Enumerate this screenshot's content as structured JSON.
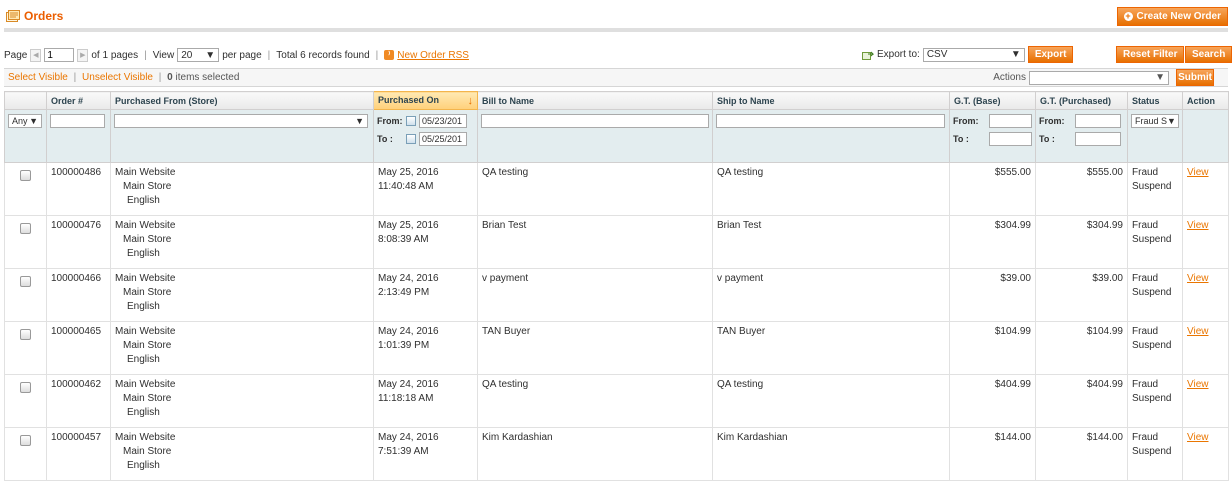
{
  "header": {
    "title": "Orders",
    "create_label": "Create New Order"
  },
  "pager": {
    "page_label": "Page",
    "page_value": "1",
    "of_pages": "of 1 pages",
    "view_label": "View",
    "view_value": "20",
    "per_page": "per page",
    "total": "Total 6 records found",
    "rss_label": "New Order RSS"
  },
  "export": {
    "label": "Export to:",
    "format": "CSV",
    "button": "Export"
  },
  "buttons": {
    "reset": "Reset Filter",
    "search": "Search"
  },
  "massaction": {
    "select_visible": "Select Visible",
    "unselect_visible": "Unselect Visible",
    "selected_count": "0",
    "selected_text": "items selected",
    "actions_label": "Actions",
    "submit": "Submit"
  },
  "columns": [
    "",
    "Order #",
    "Purchased From (Store)",
    "Purchased On",
    "Bill to Name",
    "Ship to Name",
    "G.T. (Base)",
    "G.T. (Purchased)",
    "Status",
    "Action"
  ],
  "filters": {
    "any": "Any",
    "from": "From:",
    "to": "To :",
    "date_from": "05/23/201",
    "date_to": "05/25/201",
    "status": "Fraud S"
  },
  "rows": [
    {
      "order": "100000486",
      "store1": "Main Website",
      "store2": "Main Store",
      "store3": "English",
      "date": "May 25, 2016 11:40:48 AM",
      "bill": "QA testing",
      "ship": "QA testing",
      "base": "$555.00",
      "purchased": "$555.00",
      "status": "Fraud Suspend",
      "action": "View"
    },
    {
      "order": "100000476",
      "store1": "Main Website",
      "store2": "Main Store",
      "store3": "English",
      "date": "May 25, 2016 8:08:39 AM",
      "bill": "Brian Test",
      "ship": "Brian Test",
      "base": "$304.99",
      "purchased": "$304.99",
      "status": "Fraud Suspend",
      "action": "View"
    },
    {
      "order": "100000466",
      "store1": "Main Website",
      "store2": "Main Store",
      "store3": "English",
      "date": "May 24, 2016 2:13:49 PM",
      "bill": "v payment",
      "ship": "v payment",
      "base": "$39.00",
      "purchased": "$39.00",
      "status": "Fraud Suspend",
      "action": "View"
    },
    {
      "order": "100000465",
      "store1": "Main Website",
      "store2": "Main Store",
      "store3": "English",
      "date": "May 24, 2016 1:01:39 PM",
      "bill": "TAN Buyer",
      "ship": "TAN Buyer",
      "base": "$104.99",
      "purchased": "$104.99",
      "status": "Fraud Suspend",
      "action": "View"
    },
    {
      "order": "100000462",
      "store1": "Main Website",
      "store2": "Main Store",
      "store3": "English",
      "date": "May 24, 2016 11:18:18 AM",
      "bill": "QA testing",
      "ship": "QA testing",
      "base": "$404.99",
      "purchased": "$404.99",
      "status": "Fraud Suspend",
      "action": "View"
    },
    {
      "order": "100000457",
      "store1": "Main Website",
      "store2": "Main Store",
      "store3": "English",
      "date": "May 24, 2016 7:51:39 AM",
      "bill": "Kim Kardashian",
      "ship": "Kim Kardashian",
      "base": "$144.00",
      "purchased": "$144.00",
      "status": "Fraud Suspend",
      "action": "View"
    }
  ],
  "colors": {
    "accent": "#ea7601",
    "button": "#e76f00",
    "header_bg": "#e3edef"
  }
}
